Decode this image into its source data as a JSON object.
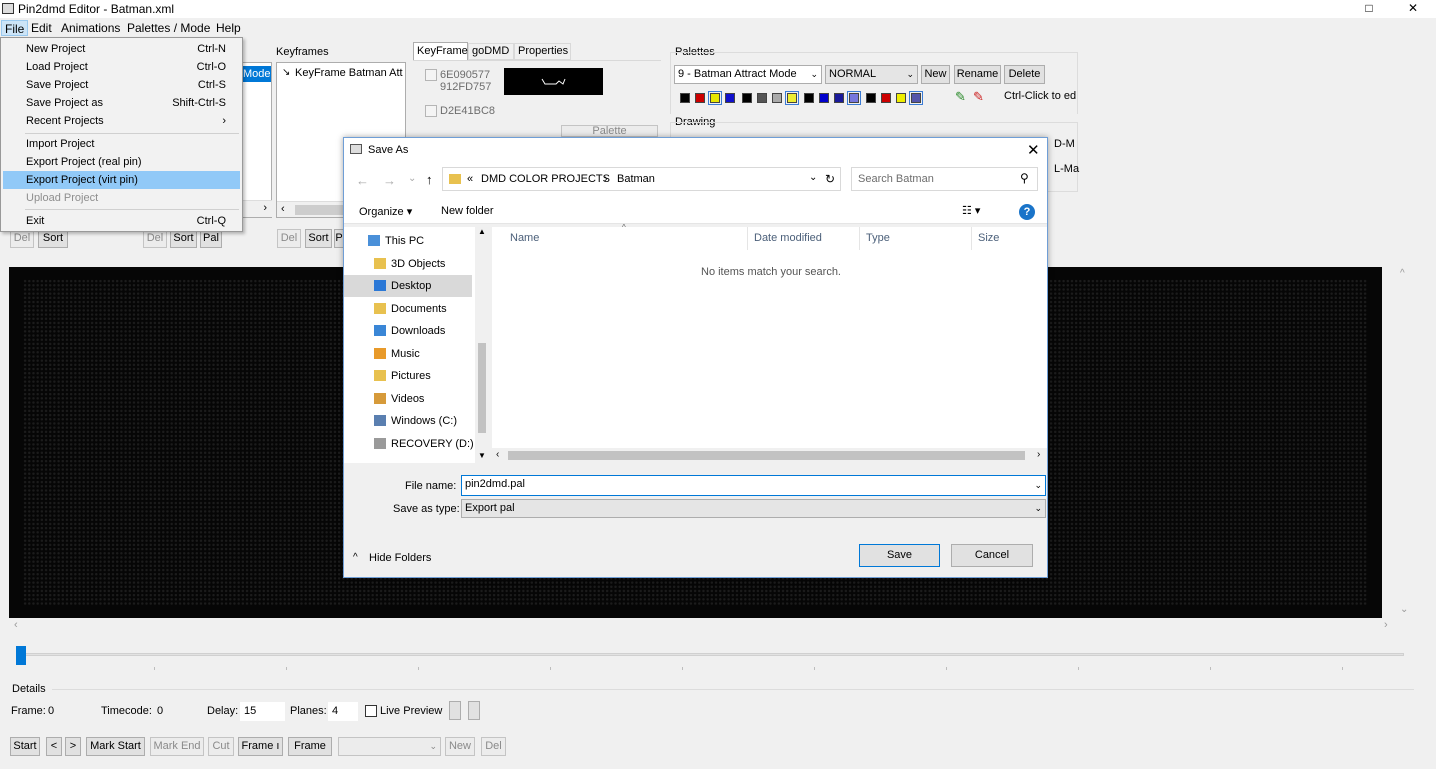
{
  "app": {
    "title": "Pin2dmd Editor - Batman.xml",
    "window_controls": [
      "□",
      "✕"
    ],
    "menubar": [
      "File",
      "Edit",
      "Animations",
      "Palettes / Mode",
      "Help"
    ]
  },
  "file_menu": {
    "items": [
      {
        "label": "New Project",
        "shortcut": "Ctrl-N"
      },
      {
        "label": "Load Project",
        "shortcut": "Ctrl-O"
      },
      {
        "label": "Save Project",
        "shortcut": "Ctrl-S"
      },
      {
        "label": "Save Project as",
        "shortcut": "Shift-Ctrl-S"
      },
      {
        "label": "Recent Projects",
        "shortcut": "›"
      },
      {
        "label": "Import Project",
        "shortcut": ""
      },
      {
        "label": "Export Project (real pin)",
        "shortcut": ""
      },
      {
        "label": "Export Project (virt pin)",
        "shortcut": ""
      },
      {
        "label": "Upload Project",
        "shortcut": ""
      },
      {
        "label": "Exit",
        "shortcut": "Ctrl-Q"
      }
    ]
  },
  "panels": {
    "scene_list_item": "Mode",
    "keyframes_title": "Keyframes",
    "keyframe_item": "KeyFrame Batman Att",
    "tabs": [
      "KeyFrame",
      "goDMD",
      "Properties"
    ],
    "hashes": [
      "6E090577",
      "912FD757",
      "D2E41BC8"
    ],
    "palette_button": "Palette",
    "list_buttons_a": [
      "Del",
      "Sort"
    ],
    "list_buttons_b": [
      "Del",
      "Sort",
      "Pal"
    ],
    "list_buttons_c": [
      "Del",
      "Sort",
      "P"
    ],
    "palettes_title": "Palettes",
    "palette_select": "9 - Batman Attract Mode",
    "palette_type": "NORMAL",
    "palette_new": "New",
    "palette_rename": "Rename",
    "palette_delete": "Delete",
    "ctrl_hint": "Ctrl-Click to ed",
    "drawing_title": "Drawing",
    "drawing_right_1": "D-M",
    "drawing_right_2": "L-Ma",
    "swatch_colors": [
      "#000000",
      "#cc0000",
      "#e8e800",
      "#1010cc",
      "#000000",
      "#555555",
      "#aaaaaa",
      "#eeee33",
      "#000000",
      "#0000cc",
      "#1a1a9a",
      "#7777dd",
      "#000000",
      "#cc0000",
      "#eeee00",
      "#5555aa"
    ]
  },
  "dialog": {
    "title": "Save As",
    "path": [
      "«",
      "DMD COLOR PROJECTS",
      "›",
      "Batman"
    ],
    "search_placeholder": "Search Batman",
    "organize": "Organize ▾",
    "new_folder": "New folder",
    "tree": [
      "This PC",
      "3D Objects",
      "Desktop",
      "Documents",
      "Downloads",
      "Music",
      "Pictures",
      "Videos",
      "Windows (C:)",
      "RECOVERY (D:)"
    ],
    "columns": [
      "Name",
      "Date modified",
      "Type",
      "Size"
    ],
    "empty_message": "No items match your search.",
    "file_name_label": "File name:",
    "file_name_value": "pin2dmd.pal",
    "save_type_label": "Save as type:",
    "save_type_value": "Export pal",
    "hide_folders": "Hide Folders",
    "save": "Save",
    "cancel": "Cancel"
  },
  "details": {
    "title": "Details",
    "frame_label": "Frame:",
    "frame_value": "0",
    "timecode_label": "Timecode:",
    "timecode_value": "0",
    "delay_label": "Delay:",
    "delay_value": "15",
    "planes_label": "Planes:",
    "planes_value": "4",
    "live_preview": "Live Preview"
  },
  "bottom_toolbar": {
    "start": "Start",
    "prev": "<",
    "next": ">",
    "mark_start": "Mark Start",
    "mark_end": "Mark End",
    "cut": "Cut",
    "frame_1": "Frame ı",
    "frame_2": "Frame",
    "new": "New",
    "del": "Del"
  },
  "timeline": {
    "position": 0
  }
}
